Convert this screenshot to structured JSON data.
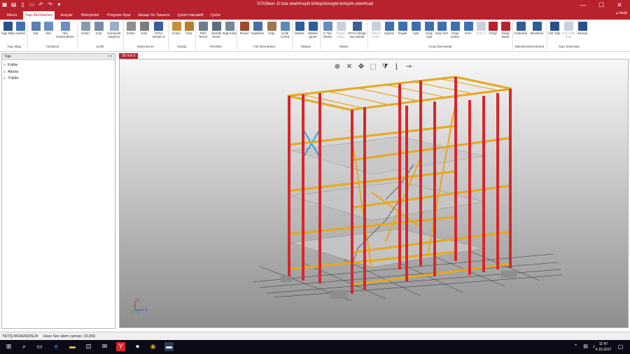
{
  "titlebar": {
    "title": "STASteel -D:\\sta steel\\maybi birleşim\\maybi birleşim.steel4cad",
    "qat_icons": [
      "app-logo-icon",
      "save-icon",
      "new-doc-icon",
      "open-icon",
      "undo-icon",
      "redo-icon",
      "dropdown-icon"
    ],
    "window_buttons": [
      "—",
      "☐",
      "✕"
    ]
  },
  "tabs": [
    "Menü",
    "Yapı Elemanları",
    "Araçlar",
    "Birleşimler",
    "Program Ayar",
    "Hesap Ve Tasarım",
    "Çizim Interaktif",
    "Çizim"
  ],
  "help_label": "Help",
  "ribbon": {
    "buttons": [
      "Yapı Bilgi",
      "Ayarlar",
      "Kat",
      "Aks",
      "Aks İsimlendirme",
      "Kolon",
      "Kiriş",
      "Kompozit Döşeme",
      "Kolon",
      "Kiriş",
      "STA4 Model Al",
      "Kolon",
      "Kiriş",
      "Tekil Temel",
      "Sürekli temel",
      "Bağ Kirişi",
      "Duvar",
      "Kaplama",
      "Kapı",
      "Çelik Levha",
      "Makas",
      "Makas genel",
      "H Tipi İskele",
      "Flanşlı İskele",
      "STA4 Hesap Dış Model",
      "Yapma Kolon",
      "Çapraz",
      "Kuşak",
      "Aşık",
      "Uzay Aşık",
      "Kiriş Seri",
      "Uzay Kafes",
      "Kren",
      "Kren 2",
      "Gergi",
      "Gergi Basit",
      "Korkuluk",
      "Merdiven",
      "Hol Yapı",
      "Çok Katlı Yapı",
      "Kanopi"
    ],
    "groups": [
      "Yapı Bilgi",
      "Aks&Kat",
      "Çelik",
      "Betonarme",
      "Ahşap",
      "Temeller",
      "Yük Elemanları",
      "Makas",
      "İskele",
      "Grup Elemanlar",
      "Merdiven&Korkuluk",
      "Yapı Makroları"
    ]
  },
  "panel": {
    "title": "Yapı",
    "pin": "ᵖ ×",
    "tree": [
      "Katlar",
      "Akslar",
      "Yükler"
    ]
  },
  "view": {
    "tab": "3D Kot 0",
    "axes": {
      "z": "Z",
      "y": "Y",
      "x": "X"
    }
  },
  "status": {
    "company": "YETİŞ MÜHENDİSLİK",
    "message": "Hazır Son işlem zamanı :10.359"
  },
  "taskbar": {
    "time": "11:47",
    "date": "4.10.2017"
  },
  "colors": {
    "accent": "#b7222c",
    "column": "#d8262c",
    "beam": "#e6a81e",
    "brace": "#2aa3d8"
  }
}
